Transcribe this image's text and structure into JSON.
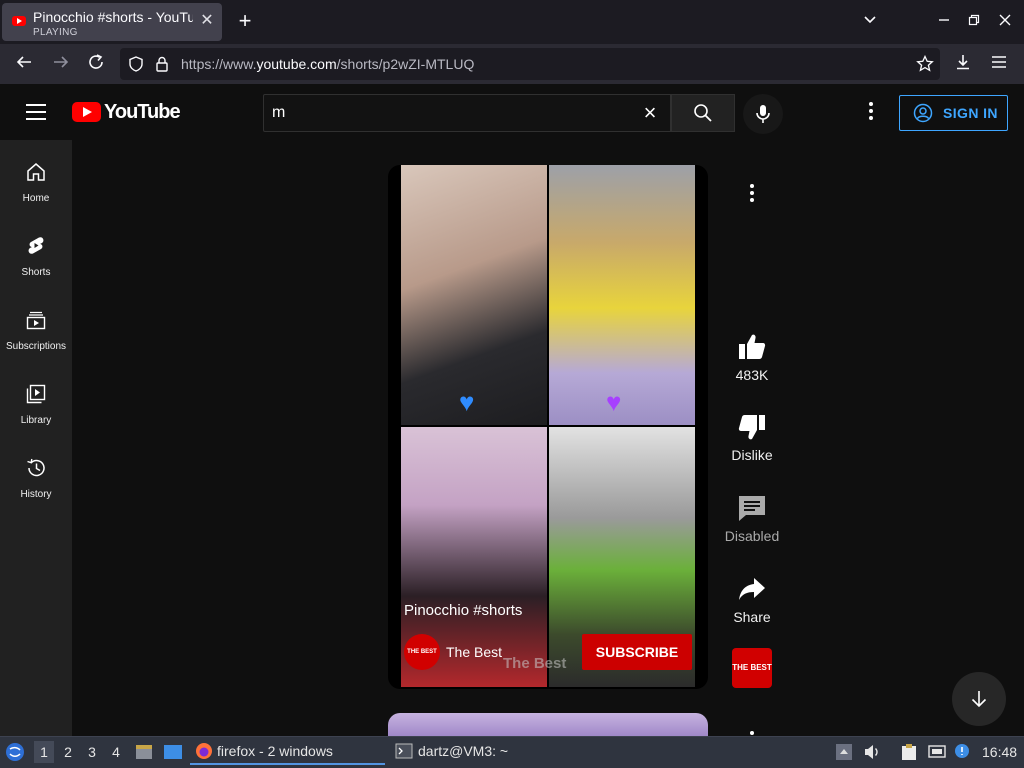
{
  "browser": {
    "tab": {
      "title": "Pinocchio #shorts - YouTube",
      "status": "PLAYING"
    },
    "url_prefix": "https://www.",
    "url_domain": "youtube.com",
    "url_path": "/shorts/p2wZI-MTLUQ"
  },
  "youtube": {
    "logo_text": "YouTube",
    "search_value": "m",
    "sign_in": "SIGN IN",
    "guide": [
      {
        "label": "Home"
      },
      {
        "label": "Shorts"
      },
      {
        "label": "Subscriptions"
      },
      {
        "label": "Library"
      },
      {
        "label": "History"
      }
    ],
    "short": {
      "title": "Pinocchio #shorts",
      "channel": "The Best",
      "channel_avatar_text": "THE BEST",
      "subscribe": "SUBSCRIBE",
      "watermark": "The Best"
    },
    "actions": {
      "like": "483K",
      "dislike": "Dislike",
      "comments": "Disabled",
      "share": "Share"
    },
    "pivot_text": "THE BEST"
  },
  "taskbar": {
    "workspaces": [
      "1",
      "2",
      "3",
      "4"
    ],
    "tasks": [
      {
        "label": "firefox - 2 windows"
      },
      {
        "label": "dartz@VM3: ~"
      }
    ],
    "clock": "16:48"
  },
  "colors": {
    "youtube_red": "#ff0000",
    "link_blue": "#3ea6ff",
    "subscribe_red": "#cc0000"
  }
}
